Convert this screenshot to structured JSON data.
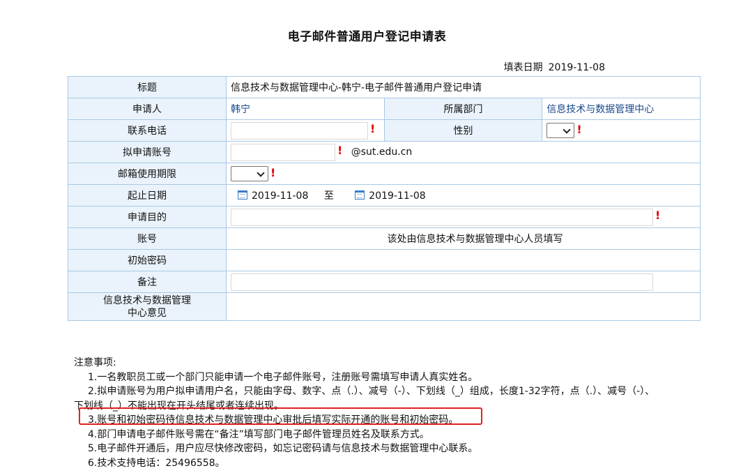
{
  "title": "电子邮件普通用户登记申请表",
  "fill_date": {
    "label": "填表日期",
    "value": "2019-11-08"
  },
  "form": {
    "subject_label": "标题",
    "subject_value": "信息技术与数据管理中心-韩宁-电子邮件普通用户登记申请",
    "applicant_label": "申请人",
    "applicant_value": "韩宁",
    "dept_label": "所属部门",
    "dept_value": "信息技术与数据管理中心",
    "phone_label": "联系电话",
    "phone_value": "",
    "gender_label": "性别",
    "gender_value": "",
    "account_label": "拟申请账号",
    "account_value": "",
    "account_domain": "@sut.edu.cn",
    "period_label": "邮箱使用期限",
    "period_value": "",
    "dates_label": "起止日期",
    "start_date": "2019-11-08",
    "to_label": "至",
    "end_date": "2019-11-08",
    "purpose_label": "申请目的",
    "purpose_value": "",
    "acct_label": "账号",
    "acct_note": "该处由信息技术与数据管理中心人员填写",
    "init_pwd_label": "初始密码",
    "remark_label": "备注",
    "remark_value": "",
    "opinion_label_1": "信息技术与数据管理",
    "opinion_label_2": "中心意见"
  },
  "required_mark": "!",
  "notes": {
    "heading": "注意事项:",
    "items": [
      "1.一名教职员工或一个部门只能申请一个电子邮件账号，注册账号需填写申请人真实姓名。",
      "2.拟申请账号为用户拟申请用户名，只能由字母、数字、点（.）、减号（-）、下划线（_）组成，长度1-32字符，点（.）、减号（-）、",
      "下划线（_）不能出现在开头结尾或者连续出现。",
      "3.账号和初始密码待信息技术与数据管理中心审批后填写实际开通的账号和初始密码。",
      "4.部门申请电子邮件账号需在“备注”填写部门电子邮件管理员姓名及联系方式。",
      "5.电子邮件开通后，用户应尽快修改密码，如忘记密码请与信息技术与数据管理中心联系。",
      "6.技术支持电话：25496558。"
    ]
  },
  "colors": {
    "label_bg": "#eaf3fb",
    "border": "#a9c9e6",
    "required": "#e00000",
    "highlight": "#e02020",
    "link": "#1b4a8c"
  }
}
